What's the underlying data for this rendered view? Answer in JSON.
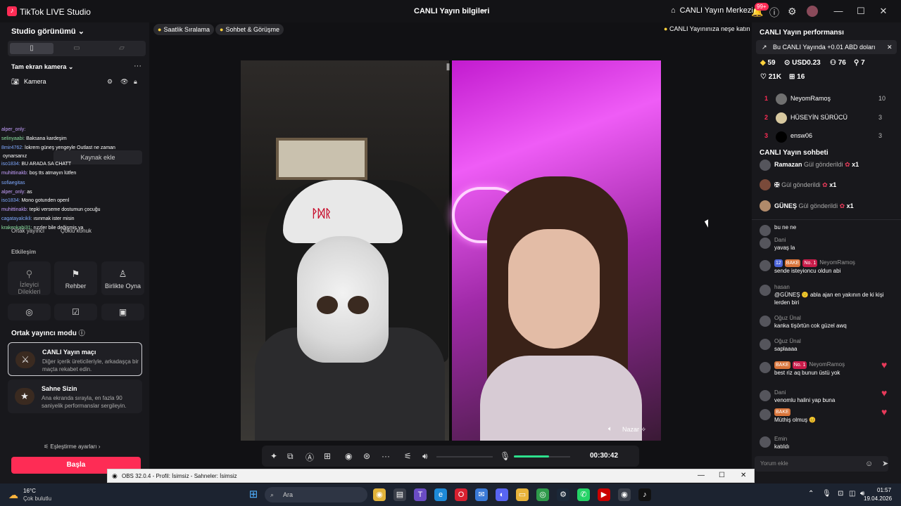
{
  "titlebar": {
    "app_title": "TikTok LIVE Studio",
    "center_title": "CANLI Yayın bilgileri",
    "live_center_label": "CANLI Yayın Merkezi",
    "notification_badge": "99+"
  },
  "left": {
    "studio_view_label": "Studio görünümü",
    "fullscreen_camera_label": "Tam ekran kamera",
    "camera_label": "Kamera",
    "add_source_label": "Kaynak ekle",
    "overlay_chat": [
      {
        "user": "alper_only:",
        "text": "",
        "extra": "▪"
      },
      {
        "user": "selinyaabi:",
        "text": "Baksana kardeşim"
      },
      {
        "user": "8mir4762:",
        "text": "lokrem güneş yengeyle Outlast ne zaman"
      },
      {
        "user": "",
        "text": "oynarsanız"
      },
      {
        "user": "iso1834:",
        "text": "BU ARADA SA CHATT"
      },
      {
        "user": "muhittinakb:",
        "text": "boş tts atmayın lütfen"
      },
      {
        "user": "sofiaegitas",
        "text": ""
      },
      {
        "user": "alper_only:",
        "text": "as"
      },
      {
        "user": "iso1834:",
        "text": "Mono gotunden openl"
      },
      {
        "user": "muhittinakb:",
        "text": "tepki verseme dostumun çocuğu"
      },
      {
        "user": "cagatayalcikli:",
        "text": "ısınmak ister misin"
      },
      {
        "user": "krakenkabi31:",
        "text": "rızzler bile değişmiş ya"
      }
    ],
    "co_host_label": "Ortak yayıncı",
    "multi_guest_label": "Çoklu konuk",
    "interaction_heading": "Etkileşim",
    "tiles": [
      {
        "label": "İzleyici Dilekleri",
        "icon": "wish-icon"
      },
      {
        "label": "Rehber",
        "icon": "guide-icon"
      },
      {
        "label": "Birlikte Oyna",
        "icon": "play-together-icon"
      }
    ],
    "co_host_mode_heading": "Ortak yayıncı modu",
    "cards": [
      {
        "title": "CANLI Yayın maçı",
        "desc": "Diğer içerik üreticileriyle, arkadaşça bir maçta rekabet edin."
      },
      {
        "title": "Sahne Sizin",
        "desc": "Ana ekranda sırayla, en fazla 90 saniyelik performanslar sergileyin."
      }
    ],
    "matching_settings_label": "Eşleştirme ayarları",
    "go_live_label": "Başla"
  },
  "stage": {
    "pills": [
      "Saatlik Sıralama",
      "Sohbet & Görüşme"
    ],
    "hint": "CANLI Yayınınıza neşe katın",
    "guest_name": "Nazar",
    "timer": "00:30:42",
    "volume_level": 0.62
  },
  "right": {
    "perf_title": "CANLI Yayın performansı",
    "promo_text": "Bu CANLI Yayında +0.01 ABD doları",
    "stats": {
      "diamonds": "59",
      "usd": "USD0.23",
      "viewers": "76",
      "new_followers": "7",
      "likes": "21K",
      "gifters": "16"
    },
    "ranking": [
      {
        "rank": "1",
        "name": "NeyomRamoş",
        "score": "10"
      },
      {
        "rank": "2",
        "name": "HÜSEYİN SÜRÜCÜ",
        "score": "3"
      },
      {
        "rank": "3",
        "name": "ensw06",
        "score": "3"
      }
    ],
    "chat_title": "CANLI Yayın sohbeti",
    "gifts": [
      {
        "name": "Ramazan",
        "action": "Gül gönderildi",
        "count": "x1"
      },
      {
        "name": "",
        "action": "Gül gönderildi",
        "count": "x1"
      },
      {
        "name": "GÜNEŞ",
        "action": "Gül gönderildi",
        "count": "x1"
      }
    ],
    "comments": [
      {
        "user": "",
        "text": "bu ne ne"
      },
      {
        "user": "Dani",
        "text": "yavaş la"
      },
      {
        "user": "NeyomRamoş",
        "text": "sende isteyioncu oldun abi",
        "badges": [
          "12",
          "BAKE",
          "No. 1"
        ]
      },
      {
        "user": "hasan",
        "text": "@GÜNEŞ 🙂 abla ajan en yakının de ki kişi lerden biri"
      },
      {
        "user": "Oğuz Ünal",
        "text": "kanka tişörtün cok güzel awq"
      },
      {
        "user": "Oğuz Ünal",
        "text": "saplaaaa"
      },
      {
        "user": "NeyomRamoş",
        "text": "best riz aq bunun üstü yok",
        "badges": [
          "BAKE",
          "No. 1"
        ]
      },
      {
        "user": "Dani",
        "text": "venomlu halini yap buna"
      },
      {
        "user": "",
        "text": "Müthiş olmuş 😊",
        "badges": [
          "BAKE"
        ]
      },
      {
        "user": "Emin",
        "text": "katıldı"
      }
    ],
    "comment_placeholder": "Yorum ekle"
  },
  "obs": {
    "title": "OBS 32.0.4 - Profil: İsimsiz - Sahneler: İsimsiz"
  },
  "taskbar": {
    "weather_temp": "16°C",
    "weather_desc": "Çok bulutlu",
    "search_placeholder": "Ara",
    "time": "01:57",
    "date": "19.04.2026"
  }
}
